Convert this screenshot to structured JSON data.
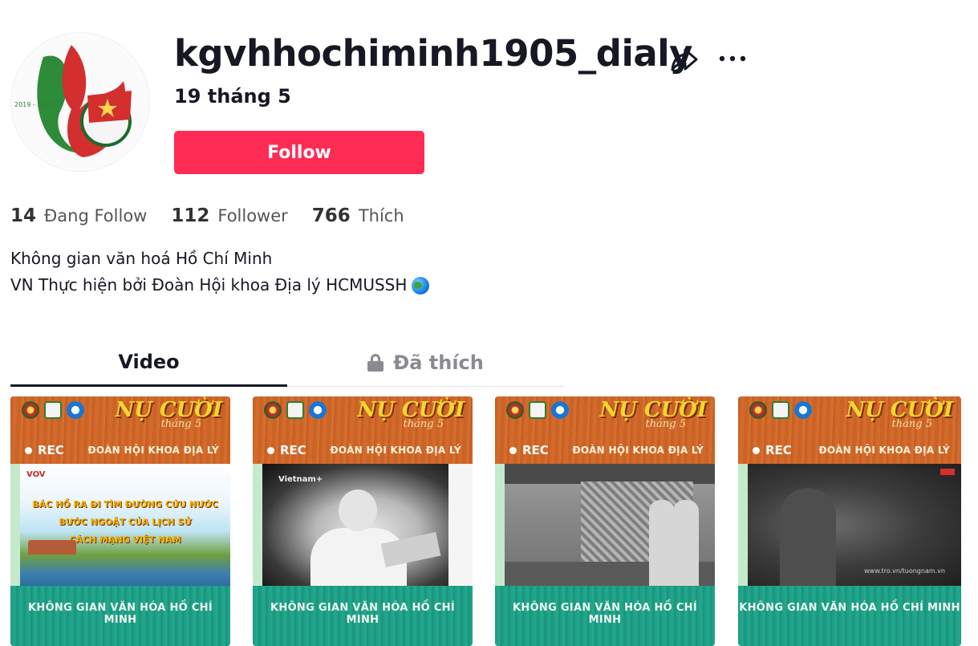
{
  "profile": {
    "username": "kgvhhochiminh1905_dialy",
    "nickname": "19 tháng 5",
    "follow_label": "Follow",
    "avatar_text": "2019 - 2022"
  },
  "stats": [
    {
      "num": "14",
      "label": "Đang Follow"
    },
    {
      "num": "112",
      "label": "Follower"
    },
    {
      "num": "766",
      "label": "Thích"
    }
  ],
  "bio": {
    "line1": "Không gian văn hoá Hồ Chí Minh",
    "line2": "VN Thực hiện bởi Đoàn Hội khoa Địa lý HCMUSSH"
  },
  "tabs": {
    "video": "Video",
    "liked": "Đã thích"
  },
  "video_card": {
    "smile": "NỤ CƯỜI",
    "thang": "tháng 5",
    "rec": "REC",
    "doan": "ĐOÀN HỘI KHOA ĐỊA LÝ",
    "doan_alt": "ĐOÀN HỘI KHOA ĐỊA LÝ",
    "bottom": "KHÔNG GIAN VĂN HÓA HỒ CHÍ MINH"
  },
  "video1": {
    "vov": "VOV",
    "title1": "BÁC HỒ RA ĐI TÌM ĐƯỜNG CỨU NƯỚC",
    "title2": "BƯỚC NGOẶT CỦA LỊCH SỬ",
    "title3": "CÁCH MẠNG VIỆT NAM"
  },
  "video2": {
    "watermark": "Vietnam+"
  },
  "video4": {
    "watermark": "www.tro.vn/tuongnam.vn"
  },
  "colors": {
    "accent": "#fe2c55",
    "text": "#161823",
    "muted": "#8a8b91"
  },
  "icons": [
    "share-icon",
    "more-icon",
    "lock-icon",
    "globe-icon"
  ]
}
